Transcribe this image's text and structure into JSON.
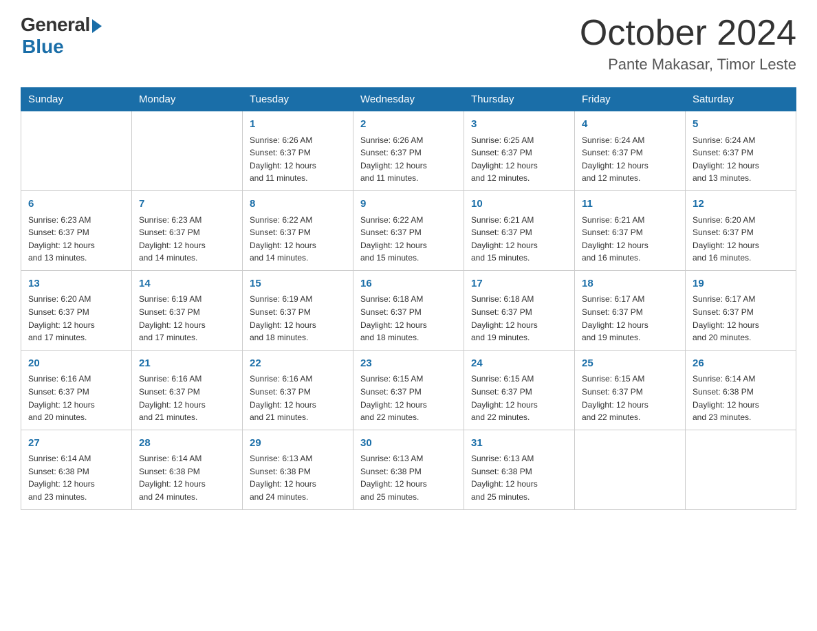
{
  "logo": {
    "general": "General",
    "blue": "Blue"
  },
  "title": "October 2024",
  "subtitle": "Pante Makasar, Timor Leste",
  "days_of_week": [
    "Sunday",
    "Monday",
    "Tuesday",
    "Wednesday",
    "Thursday",
    "Friday",
    "Saturday"
  ],
  "weeks": [
    [
      {
        "day": "",
        "info": ""
      },
      {
        "day": "",
        "info": ""
      },
      {
        "day": "1",
        "info": "Sunrise: 6:26 AM\nSunset: 6:37 PM\nDaylight: 12 hours\nand 11 minutes."
      },
      {
        "day": "2",
        "info": "Sunrise: 6:26 AM\nSunset: 6:37 PM\nDaylight: 12 hours\nand 11 minutes."
      },
      {
        "day": "3",
        "info": "Sunrise: 6:25 AM\nSunset: 6:37 PM\nDaylight: 12 hours\nand 12 minutes."
      },
      {
        "day": "4",
        "info": "Sunrise: 6:24 AM\nSunset: 6:37 PM\nDaylight: 12 hours\nand 12 minutes."
      },
      {
        "day": "5",
        "info": "Sunrise: 6:24 AM\nSunset: 6:37 PM\nDaylight: 12 hours\nand 13 minutes."
      }
    ],
    [
      {
        "day": "6",
        "info": "Sunrise: 6:23 AM\nSunset: 6:37 PM\nDaylight: 12 hours\nand 13 minutes."
      },
      {
        "day": "7",
        "info": "Sunrise: 6:23 AM\nSunset: 6:37 PM\nDaylight: 12 hours\nand 14 minutes."
      },
      {
        "day": "8",
        "info": "Sunrise: 6:22 AM\nSunset: 6:37 PM\nDaylight: 12 hours\nand 14 minutes."
      },
      {
        "day": "9",
        "info": "Sunrise: 6:22 AM\nSunset: 6:37 PM\nDaylight: 12 hours\nand 15 minutes."
      },
      {
        "day": "10",
        "info": "Sunrise: 6:21 AM\nSunset: 6:37 PM\nDaylight: 12 hours\nand 15 minutes."
      },
      {
        "day": "11",
        "info": "Sunrise: 6:21 AM\nSunset: 6:37 PM\nDaylight: 12 hours\nand 16 minutes."
      },
      {
        "day": "12",
        "info": "Sunrise: 6:20 AM\nSunset: 6:37 PM\nDaylight: 12 hours\nand 16 minutes."
      }
    ],
    [
      {
        "day": "13",
        "info": "Sunrise: 6:20 AM\nSunset: 6:37 PM\nDaylight: 12 hours\nand 17 minutes."
      },
      {
        "day": "14",
        "info": "Sunrise: 6:19 AM\nSunset: 6:37 PM\nDaylight: 12 hours\nand 17 minutes."
      },
      {
        "day": "15",
        "info": "Sunrise: 6:19 AM\nSunset: 6:37 PM\nDaylight: 12 hours\nand 18 minutes."
      },
      {
        "day": "16",
        "info": "Sunrise: 6:18 AM\nSunset: 6:37 PM\nDaylight: 12 hours\nand 18 minutes."
      },
      {
        "day": "17",
        "info": "Sunrise: 6:18 AM\nSunset: 6:37 PM\nDaylight: 12 hours\nand 19 minutes."
      },
      {
        "day": "18",
        "info": "Sunrise: 6:17 AM\nSunset: 6:37 PM\nDaylight: 12 hours\nand 19 minutes."
      },
      {
        "day": "19",
        "info": "Sunrise: 6:17 AM\nSunset: 6:37 PM\nDaylight: 12 hours\nand 20 minutes."
      }
    ],
    [
      {
        "day": "20",
        "info": "Sunrise: 6:16 AM\nSunset: 6:37 PM\nDaylight: 12 hours\nand 20 minutes."
      },
      {
        "day": "21",
        "info": "Sunrise: 6:16 AM\nSunset: 6:37 PM\nDaylight: 12 hours\nand 21 minutes."
      },
      {
        "day": "22",
        "info": "Sunrise: 6:16 AM\nSunset: 6:37 PM\nDaylight: 12 hours\nand 21 minutes."
      },
      {
        "day": "23",
        "info": "Sunrise: 6:15 AM\nSunset: 6:37 PM\nDaylight: 12 hours\nand 22 minutes."
      },
      {
        "day": "24",
        "info": "Sunrise: 6:15 AM\nSunset: 6:37 PM\nDaylight: 12 hours\nand 22 minutes."
      },
      {
        "day": "25",
        "info": "Sunrise: 6:15 AM\nSunset: 6:37 PM\nDaylight: 12 hours\nand 22 minutes."
      },
      {
        "day": "26",
        "info": "Sunrise: 6:14 AM\nSunset: 6:38 PM\nDaylight: 12 hours\nand 23 minutes."
      }
    ],
    [
      {
        "day": "27",
        "info": "Sunrise: 6:14 AM\nSunset: 6:38 PM\nDaylight: 12 hours\nand 23 minutes."
      },
      {
        "day": "28",
        "info": "Sunrise: 6:14 AM\nSunset: 6:38 PM\nDaylight: 12 hours\nand 24 minutes."
      },
      {
        "day": "29",
        "info": "Sunrise: 6:13 AM\nSunset: 6:38 PM\nDaylight: 12 hours\nand 24 minutes."
      },
      {
        "day": "30",
        "info": "Sunrise: 6:13 AM\nSunset: 6:38 PM\nDaylight: 12 hours\nand 25 minutes."
      },
      {
        "day": "31",
        "info": "Sunrise: 6:13 AM\nSunset: 6:38 PM\nDaylight: 12 hours\nand 25 minutes."
      },
      {
        "day": "",
        "info": ""
      },
      {
        "day": "",
        "info": ""
      }
    ]
  ]
}
